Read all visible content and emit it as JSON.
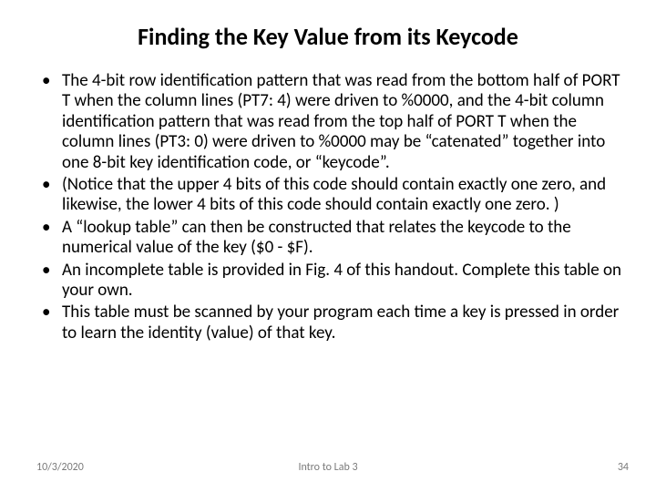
{
  "title": "Finding the Key Value from its Keycode",
  "bullets": [
    "The 4-bit row identification pattern that was read from the bottom half of PORT T when the column lines (PT7: 4) were driven to %0000, and the 4-bit column identification pattern that was read from the top half of PORT T when the column lines (PT3: 0) were driven to %0000 may be “catenated” together into one 8-bit key identification code, or “keycode”.",
    "(Notice that the upper 4 bits of this code should contain exactly one zero, and likewise, the lower 4 bits of this code should contain exactly one zero. )",
    "A “lookup table” can then be constructed that relates the keycode to the numerical value of the key ($0 - $F).",
    "An incomplete table is provided in Fig. 4 of this handout. Complete this table on your own.",
    "This table must be scanned by your program each time a key is pressed in order to learn the identity (value) of that key."
  ],
  "footer": {
    "date": "10/3/2020",
    "mid": "Intro to Lab 3",
    "page": "34"
  }
}
